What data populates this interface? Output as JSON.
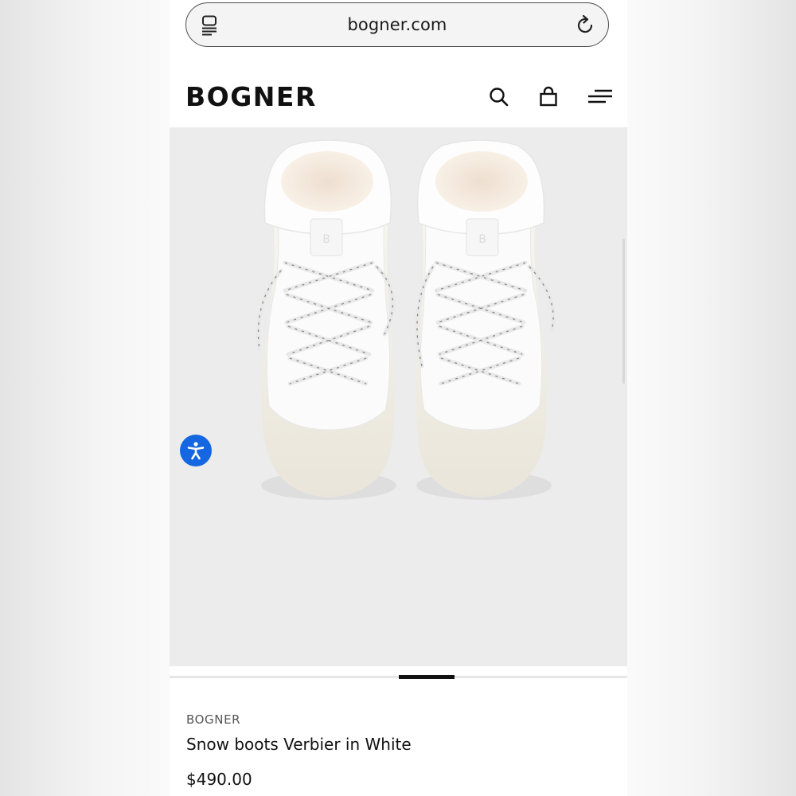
{
  "browser": {
    "url": "bogner.com",
    "icons": {
      "reader": "reader-mode-icon",
      "reload": "reload-icon"
    }
  },
  "header": {
    "logo": "BOGNER",
    "icons": {
      "search": "search-icon",
      "cart": "shopping-bag-icon",
      "menu": "menu-icon"
    }
  },
  "gallery": {
    "image": "white-snow-boots-photo",
    "background_color": "#ececec",
    "carousel_progress": 0.12
  },
  "accessibility": {
    "icon": "accessibility-icon",
    "color": "#1467e0"
  },
  "product": {
    "brand": "BOGNER",
    "title": "Snow boots Verbier in White",
    "price": "$490.00"
  }
}
